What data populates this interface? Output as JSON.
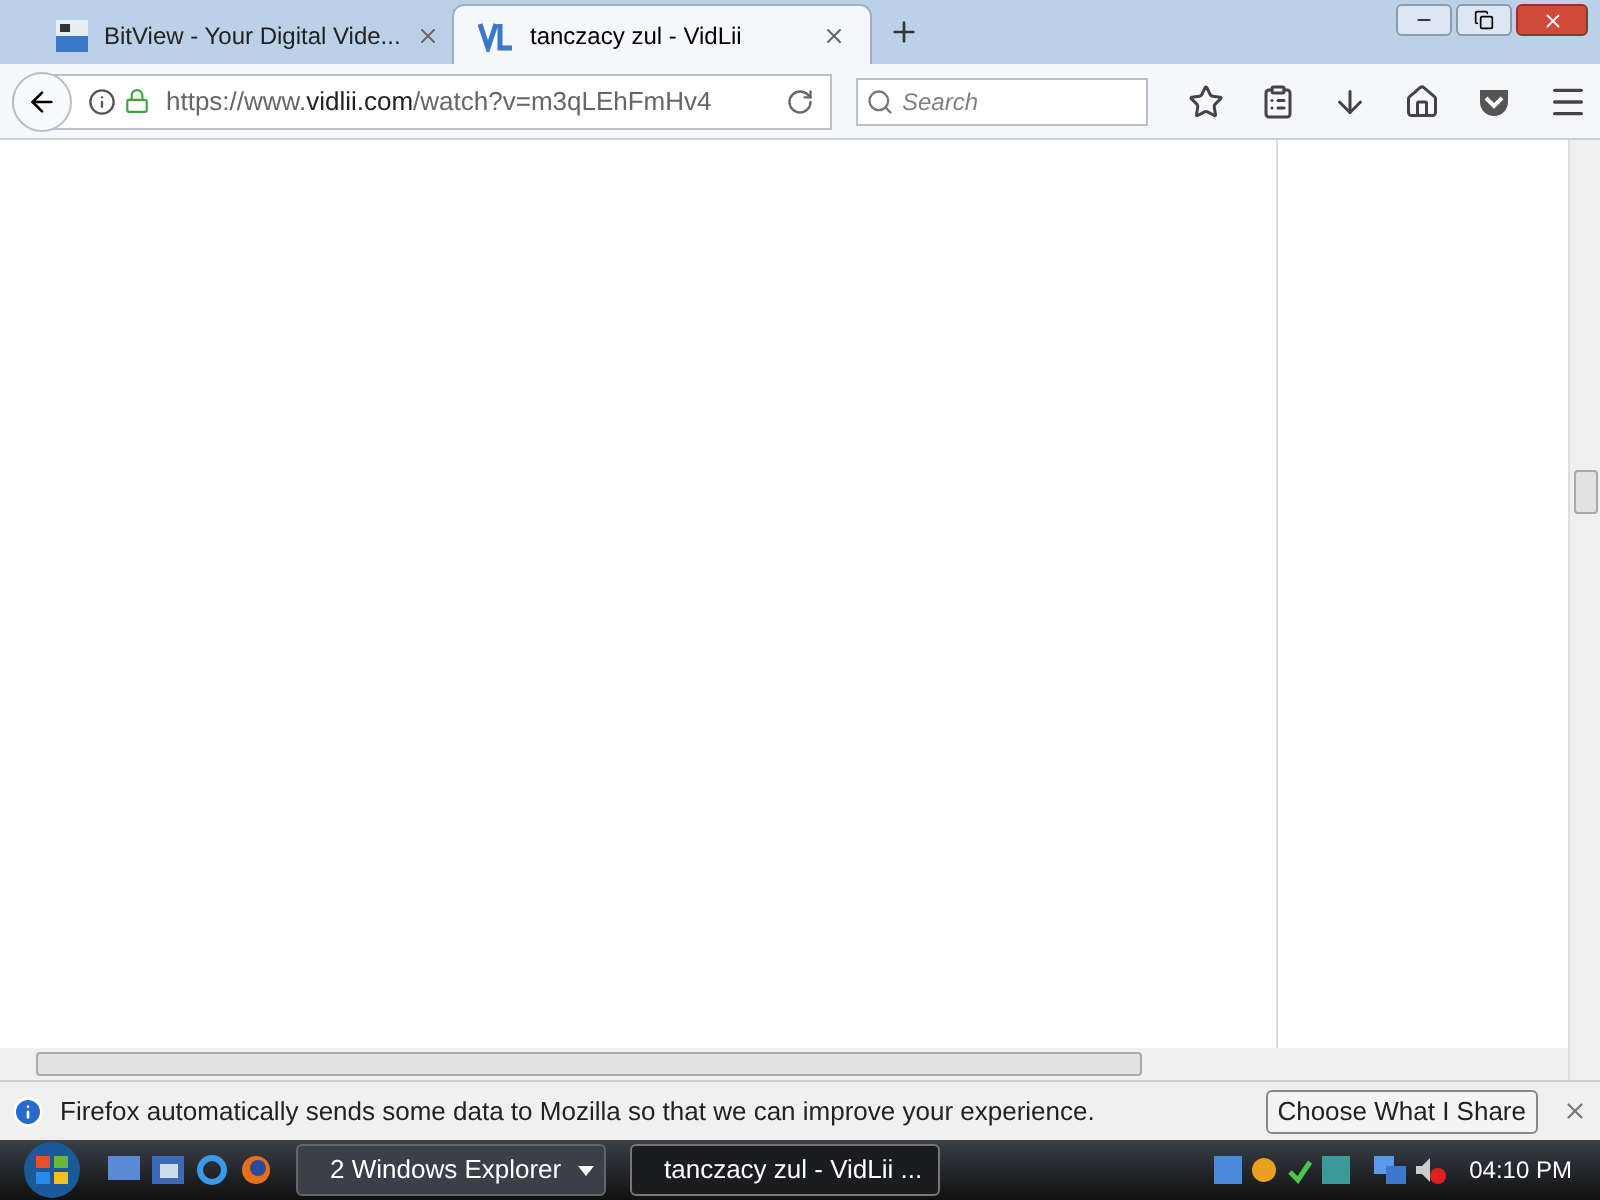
{
  "tabs": [
    {
      "title": "BitView - Your Digital Vide...",
      "kind": "bitview",
      "selected": false
    },
    {
      "title": "tanczacy zul - VidLii",
      "kind": "vidlii",
      "selected": true
    }
  ],
  "address_bar": {
    "url_host": "https://www.",
    "url_domain": "vidlii.com",
    "url_path": "/watch?v=m3qLEhFmHv4"
  },
  "search": {
    "placeholder": "Search"
  },
  "notification": {
    "message": "Firefox automatically sends some data to Mozilla so that we can improve your experience.",
    "button": "Choose What I Share"
  },
  "taskbar": {
    "buttons": [
      {
        "label": "2 Windows Explorer",
        "kind": "group",
        "selected": false
      },
      {
        "label": "tanczacy zul - VidLii ...",
        "kind": "window",
        "selected": true
      }
    ],
    "clock": "04:10 PM"
  }
}
